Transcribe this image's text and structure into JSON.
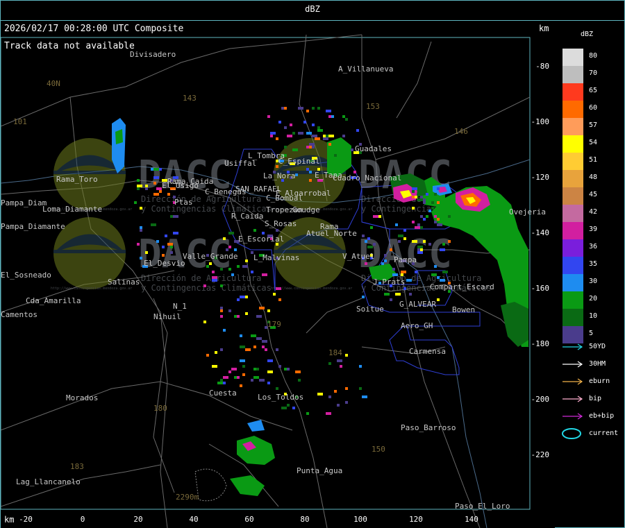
{
  "window": {
    "title": "dBZ"
  },
  "header": {
    "timestamp": "2026/02/17 00:28:00 UTC Composite",
    "track_status": "Track data not available",
    "km_label_top": "km",
    "km_label_bottom": "km"
  },
  "axes": {
    "x_ticks": [
      "-20",
      "0",
      "20",
      "40",
      "60",
      "80",
      "100",
      "120",
      "140"
    ],
    "y_ticks": [
      "-80",
      "-100",
      "-120",
      "-140",
      "-160",
      "-180",
      "-200",
      "-220"
    ]
  },
  "legend": {
    "title": "dBZ",
    "scale": [
      {
        "value": "80",
        "color": "#dcdcdc"
      },
      {
        "value": "70",
        "color": "#bebebe"
      },
      {
        "value": "65",
        "color": "#ff3a1e"
      },
      {
        "value": "60",
        "color": "#ff6a00"
      },
      {
        "value": "57",
        "color": "#ff9c5a"
      },
      {
        "value": "54",
        "color": "#ffff00"
      },
      {
        "value": "51",
        "color": "#ffcc33"
      },
      {
        "value": "48",
        "color": "#e8a33c"
      },
      {
        "value": "45",
        "color": "#cc8444"
      },
      {
        "value": "42",
        "color": "#c46aa0"
      },
      {
        "value": "39",
        "color": "#d21fa0"
      },
      {
        "value": "36",
        "color": "#7a1edc"
      },
      {
        "value": "35",
        "color": "#3246f0"
      },
      {
        "value": "30",
        "color": "#1e8cf0"
      },
      {
        "value": "20",
        "color": "#0a9a14"
      },
      {
        "value": "10",
        "color": "#0a6a14"
      },
      {
        "value": "5",
        "color": "#4a3c8c"
      }
    ],
    "tracks": [
      {
        "label": "50YD",
        "color": "#22d8e6"
      },
      {
        "label": "30HM",
        "color": "#ffffff"
      },
      {
        "label": "eburn",
        "color": "#f2b24a"
      },
      {
        "label": "bip",
        "color": "#ffb0d0"
      },
      {
        "label": "eb+bip",
        "color": "#d02ad8"
      },
      {
        "label": "current",
        "color": "#22d8e6"
      }
    ]
  },
  "watermark": {
    "brand": "DACC",
    "line1": "Dirección de Agricultura",
    "line2": "y Contingencias Climáticas",
    "url": "http://www.contingencias.mendoza.gov.ar"
  },
  "places": [
    {
      "name": "Divisadero"
    },
    {
      "name": "A_Villanueva"
    },
    {
      "name": "40N"
    },
    {
      "name": "143"
    },
    {
      "name": "153"
    },
    {
      "name": "101"
    },
    {
      "name": "146"
    },
    {
      "name": "Guadales"
    },
    {
      "name": "L_Tombra"
    },
    {
      "name": "Usiffal"
    },
    {
      "name": "C_Espinal"
    },
    {
      "name": "E_Tapa"
    },
    {
      "name": "Cuadro_Nacional"
    },
    {
      "name": "La_Nora"
    },
    {
      "name": "Rama_Caida"
    },
    {
      "name": "C_Benegas"
    },
    {
      "name": "SAN_RAFAEL"
    },
    {
      "name": "E_Algarrobal"
    },
    {
      "name": "C_Bombal"
    },
    {
      "name": "Ptas"
    },
    {
      "name": "El_Usigo"
    },
    {
      "name": "Pampa_Diamante"
    },
    {
      "name": "Loma_Diamante"
    },
    {
      "name": "R_Caida"
    },
    {
      "name": "S_Rosas"
    },
    {
      "name": "Atuel_Norte"
    },
    {
      "name": "E_Escorial"
    },
    {
      "name": "V_Atuel"
    },
    {
      "name": "Valle_Grande"
    },
    {
      "name": "L_Malvinas"
    },
    {
      "name": "El_Desvio"
    },
    {
      "name": "Salinas"
    },
    {
      "name": "J_Prats"
    },
    {
      "name": "Compart_Escard"
    },
    {
      "name": "G_ALVEAR"
    },
    {
      "name": "Bowen"
    },
    {
      "name": "Soitue"
    },
    {
      "name": "Cda_Amarilla"
    },
    {
      "name": "N_1"
    },
    {
      "name": "Nihuil"
    },
    {
      "name": "Aero_GH"
    },
    {
      "name": "179"
    },
    {
      "name": "184"
    },
    {
      "name": "Carmensa"
    },
    {
      "name": "Los_Toldos"
    },
    {
      "name": "Morados"
    },
    {
      "name": "180"
    },
    {
      "name": "Paso_Barroso"
    },
    {
      "name": "150"
    },
    {
      "name": "183"
    },
    {
      "name": "Lag_Llancanelo"
    },
    {
      "name": "Punta_Agua"
    },
    {
      "name": "Paso_El_Loro"
    },
    {
      "name": "Ovejeria"
    },
    {
      "name": "Rama"
    },
    {
      "name": "El_Sosneado"
    },
    {
      "name": "Cuesta"
    },
    {
      "name": "Pampa"
    },
    {
      "name": "Pampa_Diam"
    },
    {
      "name": "Camentos"
    },
    {
      "name": "2290m"
    },
    {
      "name": "Rama_Toro"
    },
    {
      "name": "Tropezon"
    },
    {
      "name": "Goudge"
    }
  ],
  "echo_colors": {
    "green": "#0a9a14",
    "dark_green": "#0a6a14",
    "purple": "#4a3c8c",
    "blue": "#3246f0",
    "cyan": "#1e8cf0",
    "magenta": "#d21fa0",
    "yellow": "#ffff00",
    "orange": "#ff6a00"
  }
}
